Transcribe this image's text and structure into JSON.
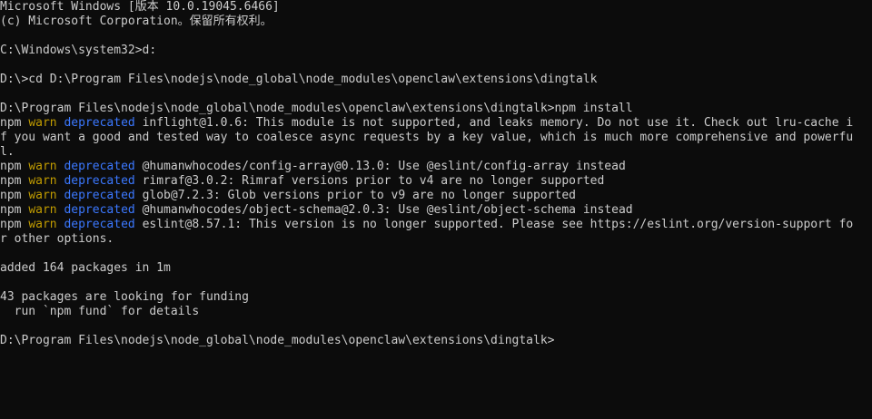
{
  "colors": {
    "background": "#0c0c0c",
    "text": "#cccccc",
    "warn": "#c19c00",
    "deprecated": "#3b78ff"
  },
  "terminal": {
    "header_line1": "Microsoft Windows [版本 10.0.19045.6466]",
    "header_line2": "(c) Microsoft Corporation。保留所有权利。",
    "cmd1": "C:\\Windows\\system32>d:",
    "cmd2": "D:\\>cd D:\\Program Files\\nodejs\\node_global\\node_modules\\openclaw\\extensions\\dingtalk",
    "cmd3": "D:\\Program Files\\nodejs\\node_global\\node_modules\\openclaw\\extensions\\dingtalk>npm install",
    "npm_label": "npm",
    "warn_label": "warn",
    "deprecated_label": "deprecated",
    "warnings": [
      {
        "message": "inflight@1.0.6: This module is not supported, and leaks memory. Do not use it. Check out lru-cache i",
        "continuation": [
          "f you want a good and tested way to coalesce async requests by a key value, which is much more comprehensive and powerfu",
          "l."
        ]
      },
      {
        "message": "@humanwhocodes/config-array@0.13.0: Use @eslint/config-array instead",
        "continuation": []
      },
      {
        "message": "rimraf@3.0.2: Rimraf versions prior to v4 are no longer supported",
        "continuation": []
      },
      {
        "message": "glob@7.2.3: Glob versions prior to v9 are no longer supported",
        "continuation": []
      },
      {
        "message": "@humanwhocodes/object-schema@2.0.3: Use @eslint/object-schema instead",
        "continuation": []
      },
      {
        "message": "eslint@8.57.1: This version is no longer supported. Please see https://eslint.org/version-support fo",
        "continuation": [
          "r other options."
        ]
      }
    ],
    "added_line": "added 164 packages in 1m",
    "funding_line1": "43 packages are looking for funding",
    "funding_line2": "  run `npm fund` for details",
    "prompt": "D:\\Program Files\\nodejs\\node_global\\node_modules\\openclaw\\extensions\\dingtalk>"
  }
}
